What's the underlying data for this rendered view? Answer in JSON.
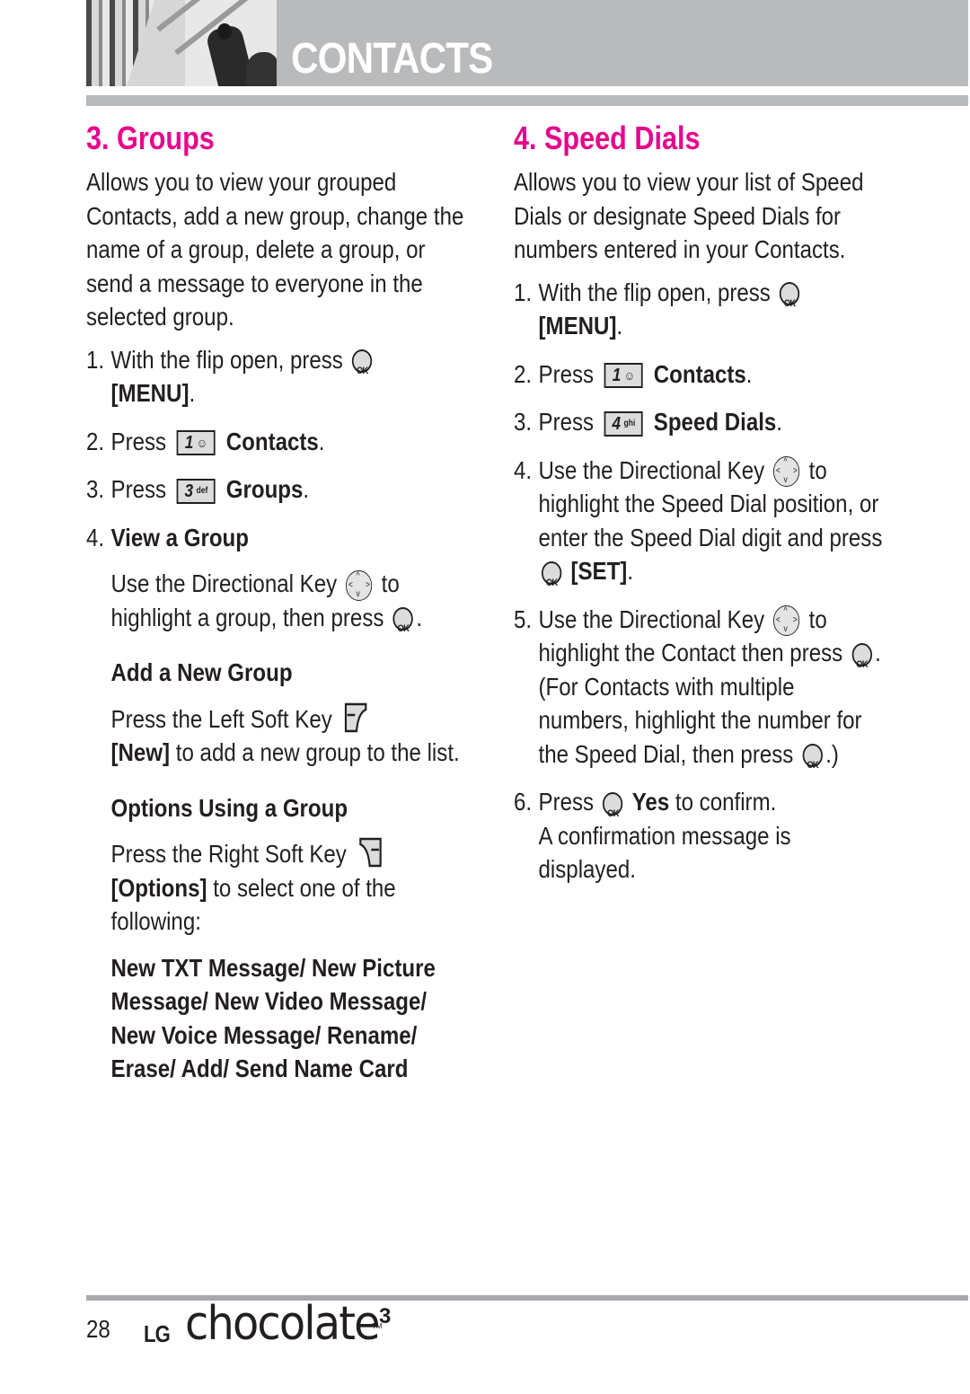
{
  "header": {
    "title": "CONTACTS"
  },
  "left": {
    "title": "3. Groups",
    "intro": "Allows you to view your grouped Contacts, add a new group, change the name of a group, delete a group, or send a message to everyone in the selected group.",
    "steps": [
      {
        "num": "1.",
        "pre": "With the flip open, press",
        "icon": "ok-icon",
        "bold": "[MENU]",
        "post": "."
      },
      {
        "num": "2.",
        "pre": "Press",
        "key_digit": "1",
        "key_letters": "",
        "bold": "Contacts",
        "post": "."
      },
      {
        "num": "3.",
        "pre": "Press",
        "key_digit": "3",
        "key_letters": "def",
        "bold": "Groups",
        "post": "."
      },
      {
        "num": "4.",
        "bold": "View a Group"
      }
    ],
    "view_group": {
      "pre": "Use the Directional Key",
      "mid": "to highlight a group, then press",
      "post": "."
    },
    "add_group": {
      "heading": "Add a New Group",
      "pre": "Press the Left Soft Key",
      "bold": "[New]",
      "post": "to add a new group to the list."
    },
    "options": {
      "heading": "Options Using a Group",
      "pre": "Press the Right Soft Key",
      "bold": "[Options]",
      "post": "to select one of the following:",
      "list": "New TXT Message/ New Picture Message/ New Video Message/  New Voice Message/ Rename/ Erase/ Add/ Send Name Card"
    }
  },
  "right": {
    "title": "4. Speed Dials",
    "intro": "Allows you to view your list of Speed Dials or designate Speed Dials for numbers entered in your Contacts.",
    "steps": [
      {
        "num": "1.",
        "pre": "With the flip open, press",
        "bold": "[MENU]",
        "post": "."
      },
      {
        "num": "2.",
        "pre": "Press",
        "key_digit": "1",
        "bold": "Contacts",
        "post": "."
      },
      {
        "num": "3.",
        "pre": "Press",
        "key_digit": "4",
        "key_letters": "ghi",
        "bold": "Speed Dials",
        "post": "."
      },
      {
        "num": "4.",
        "pre": "Use the Directional Key",
        "mid": "to highlight the Speed Dial position, or enter the Speed Dial digit and press",
        "bold": "[SET]",
        "post": "."
      },
      {
        "num": "5.",
        "pre": "Use the Directional Key",
        "mid": "to highlight the Contact then press",
        "mid2": ". (For Contacts with multiple numbers, highlight the number for the Speed Dial, then press",
        "post": ".)"
      },
      {
        "num": "6.",
        "pre": "Press",
        "bold": "Yes",
        "post": "to confirm.",
        "extra": "A confirmation message is displayed."
      }
    ]
  },
  "footer": {
    "page_number": "28",
    "brand_lg": "LG",
    "brand_name": "chocolate",
    "brand_tm": "TM",
    "brand_version": "3"
  },
  "colors": {
    "accent": "#e5068c",
    "header_gray": "#b9babc",
    "text": "#231f20"
  }
}
